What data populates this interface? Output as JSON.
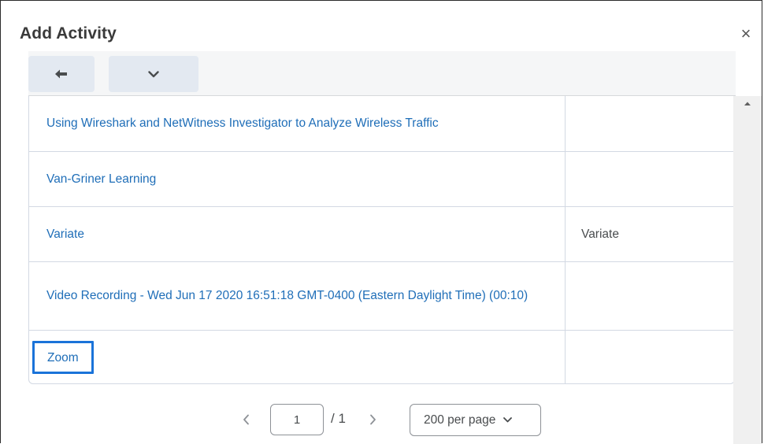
{
  "dialog": {
    "title": "Add Activity",
    "close_icon": "×"
  },
  "toolbar": {
    "back_icon": "arrow-left-icon",
    "more_icon": "chevron-down-icon"
  },
  "rows": [
    {
      "name": "Using Wireshark and NetWitness Investigator to Analyze Wireless Traffic",
      "type": ""
    },
    {
      "name": "Van-Griner Learning",
      "type": ""
    },
    {
      "name": "Variate",
      "type": "Variate"
    },
    {
      "name": "Video Recording - Wed Jun 17 2020 16:51:18 GMT-0400 (Eastern Daylight Time) (00:10)",
      "type": ""
    },
    {
      "name": "Zoom",
      "type": "",
      "focused": true
    }
  ],
  "pagination": {
    "current_page": "1",
    "total": "/ 1",
    "page_size": "200 per page"
  },
  "colors": {
    "link": "#1f6eb8",
    "focus": "#1a73d9",
    "toolbar_button": "#e3e9f1"
  }
}
